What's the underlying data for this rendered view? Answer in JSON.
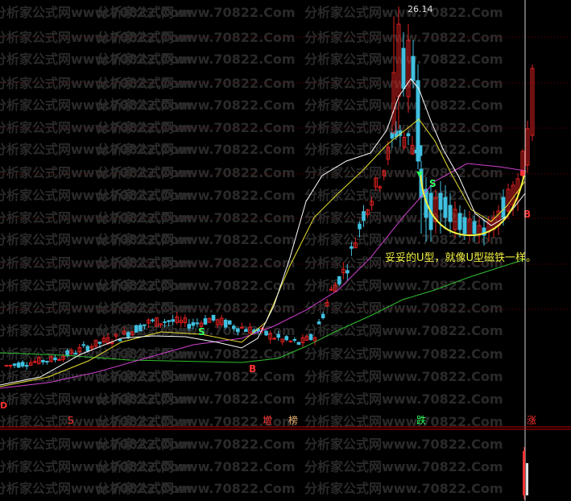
{
  "watermark": {
    "text": "分析家公式网www.70822.Com",
    "color": "#2a2a2a"
  },
  "colors": {
    "background": "#000000",
    "up_candle": "#e02020",
    "down_candle": "#40c0e0",
    "ma_fast": "#ffffff",
    "ma_mid": "#e8e030",
    "ma_slow": "#d040d0",
    "ma_long": "#30c030",
    "u_curve": "#f0f040",
    "grid_dotted": "#700000",
    "panel_divider": "#c00000",
    "label_red": "#ff3030",
    "label_green": "#30ff60",
    "marker_text_tan": "#e8b070"
  },
  "chart_data": {
    "type": "candlestick",
    "title": "",
    "xlabel": "",
    "ylabel": "",
    "peak_label": "26.14",
    "annotation": "妥妥的U型，就像U型磁铁一样。",
    "bar_count": 130,
    "signals": [
      {
        "bar": 61,
        "text": "S",
        "color": "#30ff60"
      },
      {
        "bar": 78,
        "text": "B",
        "color": "#ff3030"
      },
      {
        "bar": 132,
        "text": "S",
        "color": "#30ff60"
      },
      {
        "bar": 161,
        "text": "B",
        "color": "#ff3030"
      }
    ],
    "bottom_labels": [
      {
        "text": "S",
        "color": "#ff3030"
      },
      {
        "text": "增",
        "color": "#ff3030"
      },
      {
        "text": "榜",
        "color": "#e8b070"
      },
      {
        "text": "跌",
        "color": "#30ff60"
      },
      {
        "text": "涨",
        "color": "#ff3030"
      }
    ],
    "left_marker": "D"
  }
}
